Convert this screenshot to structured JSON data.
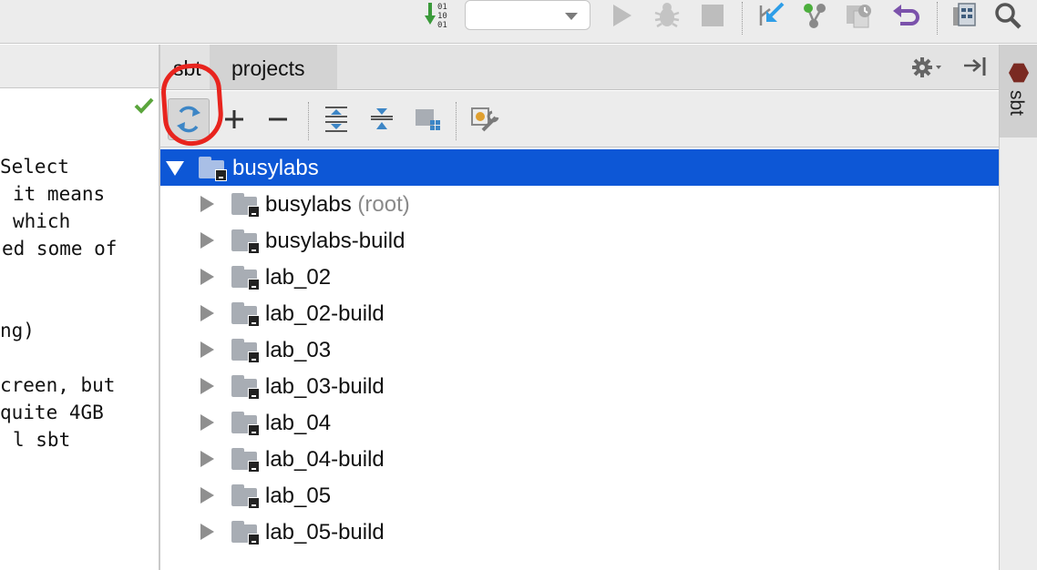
{
  "toolbar": {
    "binary_digits": [
      "01",
      "10",
      "01"
    ],
    "run_config_value": "",
    "icons": [
      "binary-download-icon",
      "run-config-dropdown",
      "run-icon",
      "debug-icon",
      "stop-icon",
      "vcs-update-icon",
      "vcs-commit-icon",
      "vcs-compare-icon",
      "undo-icon",
      "project-structure-icon",
      "search-icon"
    ]
  },
  "editor": {
    "lines": [
      "Select",
      "it means",
      "which",
      "ed some of",
      "",
      "ng)",
      "",
      "creen, but",
      "quite 4GB",
      "l sbt"
    ]
  },
  "tool_window": {
    "tabs": [
      {
        "label": "sbt"
      },
      {
        "label": "projects"
      }
    ],
    "actions": [
      "refresh",
      "add",
      "remove",
      "expand-all",
      "collapse-all",
      "group-modules",
      "sbt-settings"
    ]
  },
  "tree": {
    "root": {
      "label": "busylabs",
      "expanded": true,
      "selected": true
    },
    "children": [
      {
        "label": "busylabs",
        "suffix": "(root)"
      },
      {
        "label": "busylabs-build",
        "suffix": ""
      },
      {
        "label": "lab_02",
        "suffix": ""
      },
      {
        "label": "lab_02-build",
        "suffix": ""
      },
      {
        "label": "lab_03",
        "suffix": ""
      },
      {
        "label": "lab_03-build",
        "suffix": ""
      },
      {
        "label": "lab_04",
        "suffix": ""
      },
      {
        "label": "lab_04-build",
        "suffix": ""
      },
      {
        "label": "lab_05",
        "suffix": ""
      },
      {
        "label": "lab_05-build",
        "suffix": ""
      }
    ]
  },
  "right_stripe": {
    "label": "sbt"
  },
  "colors": {
    "selection": "#0d57d6",
    "annotation": "#e8241e",
    "check": "#5aa53c"
  }
}
